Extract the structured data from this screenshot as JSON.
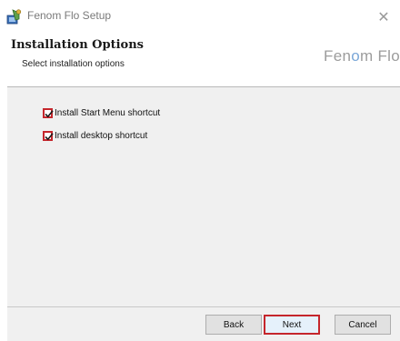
{
  "window": {
    "title": "Fenom Flo Setup",
    "close_glyph": "✕"
  },
  "banner": {
    "title": "Installation Options",
    "subtitle": "Select installation options",
    "logo_text_1": "Fen",
    "logo_text_accent": "o",
    "logo_text_2": "m Flo"
  },
  "options": [
    {
      "label": "Install Start Menu shortcut",
      "checked": true
    },
    {
      "label": "Install desktop shortcut",
      "checked": true
    }
  ],
  "buttons": {
    "back": "Back",
    "next": "Next",
    "cancel": "Cancel"
  },
  "colors": {
    "highlight": "#c5262c",
    "content_bg": "#f0f0f0",
    "logo_accent": "#7aa7d8"
  },
  "icons": {
    "app": "installer-icon",
    "close": "close-icon",
    "check": "checkmark-icon"
  }
}
